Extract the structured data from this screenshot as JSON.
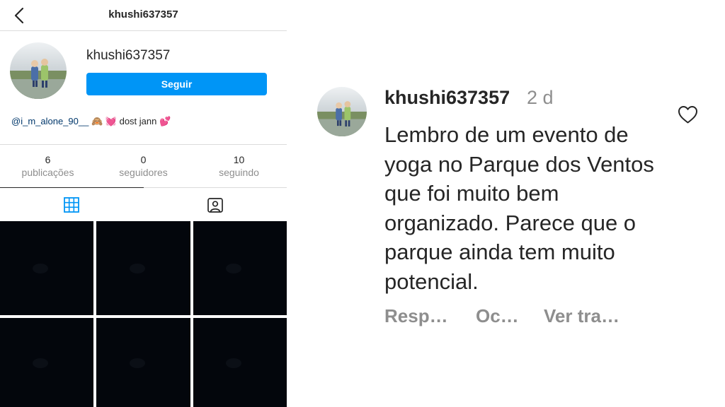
{
  "profile": {
    "header_title": "khushi637357",
    "username": "khushi637357",
    "follow_label": "Seguir",
    "bio": {
      "mention": "@i_m_alone_90__",
      "emojis": "🙈 💓",
      "text": "dost jann",
      "trailing_emoji": "💕"
    },
    "stats": [
      {
        "value": "6",
        "label": "publicações"
      },
      {
        "value": "0",
        "label": "seguidores"
      },
      {
        "value": "10",
        "label": "seguindo"
      }
    ],
    "tabs": [
      {
        "icon": "grid-icon",
        "active": true
      },
      {
        "icon": "tagged-person-icon",
        "active": false
      }
    ],
    "posts_count_visible": 6,
    "icons": {
      "back": "chevron-left-icon"
    }
  },
  "comment": {
    "username": "khushi637357",
    "time": "2 d",
    "text": "Lembro de um evento de yoga no Parque dos Ventos que foi muito bem organizado. Parece que o parque ainda tem muito potencial.",
    "actions": [
      "Resp…",
      "Oc…",
      "Ver tra…"
    ],
    "icons": {
      "like": "heart-outline-icon"
    }
  },
  "colors": {
    "accent": "#0095f6",
    "text": "#262626",
    "secondary": "#8e8e8e",
    "mention": "#00376b",
    "divider": "#dbdbdb",
    "post_background": "#03060c"
  }
}
